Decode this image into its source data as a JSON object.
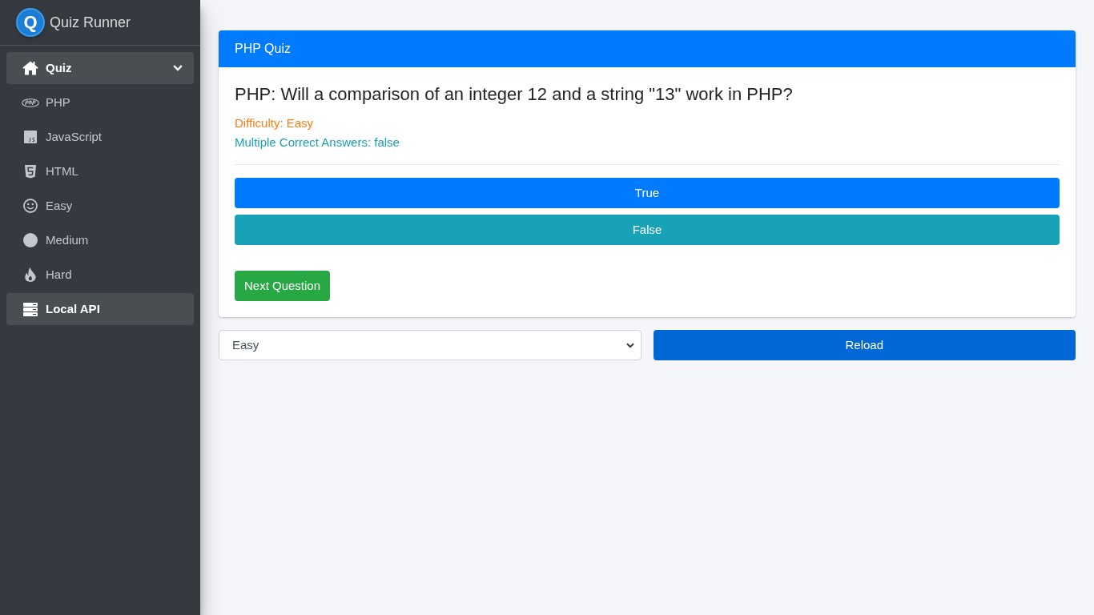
{
  "brand": {
    "logo_letter": "Q",
    "title": "Quiz Runner"
  },
  "sidebar": {
    "items": [
      {
        "label": "Quiz",
        "selected": true,
        "expanded": true,
        "children": [
          {
            "label": "PHP",
            "selected": false
          },
          {
            "label": "JavaScript",
            "selected": false
          },
          {
            "label": "HTML",
            "selected": false
          },
          {
            "label": "Easy",
            "selected": false
          },
          {
            "label": "Medium",
            "selected": false
          },
          {
            "label": "Hard",
            "selected": false
          }
        ]
      },
      {
        "label": "Local API",
        "selected": true
      }
    ]
  },
  "quiz_card": {
    "title": "PHP Quiz",
    "question": "PHP: Will a comparison of an integer 12 and a string \"13\" work in PHP?",
    "difficulty": "Difficulty: Easy",
    "multiple_answers": "Multiple Correct Answers: false",
    "answers": [
      {
        "label": "True",
        "color": "#007bff"
      },
      {
        "label": "False",
        "color": "#17a2b8"
      }
    ],
    "next_button": "Next Question"
  },
  "controls": {
    "difficulty_select": {
      "value": "Easy"
    },
    "reload_button": "Reload"
  }
}
